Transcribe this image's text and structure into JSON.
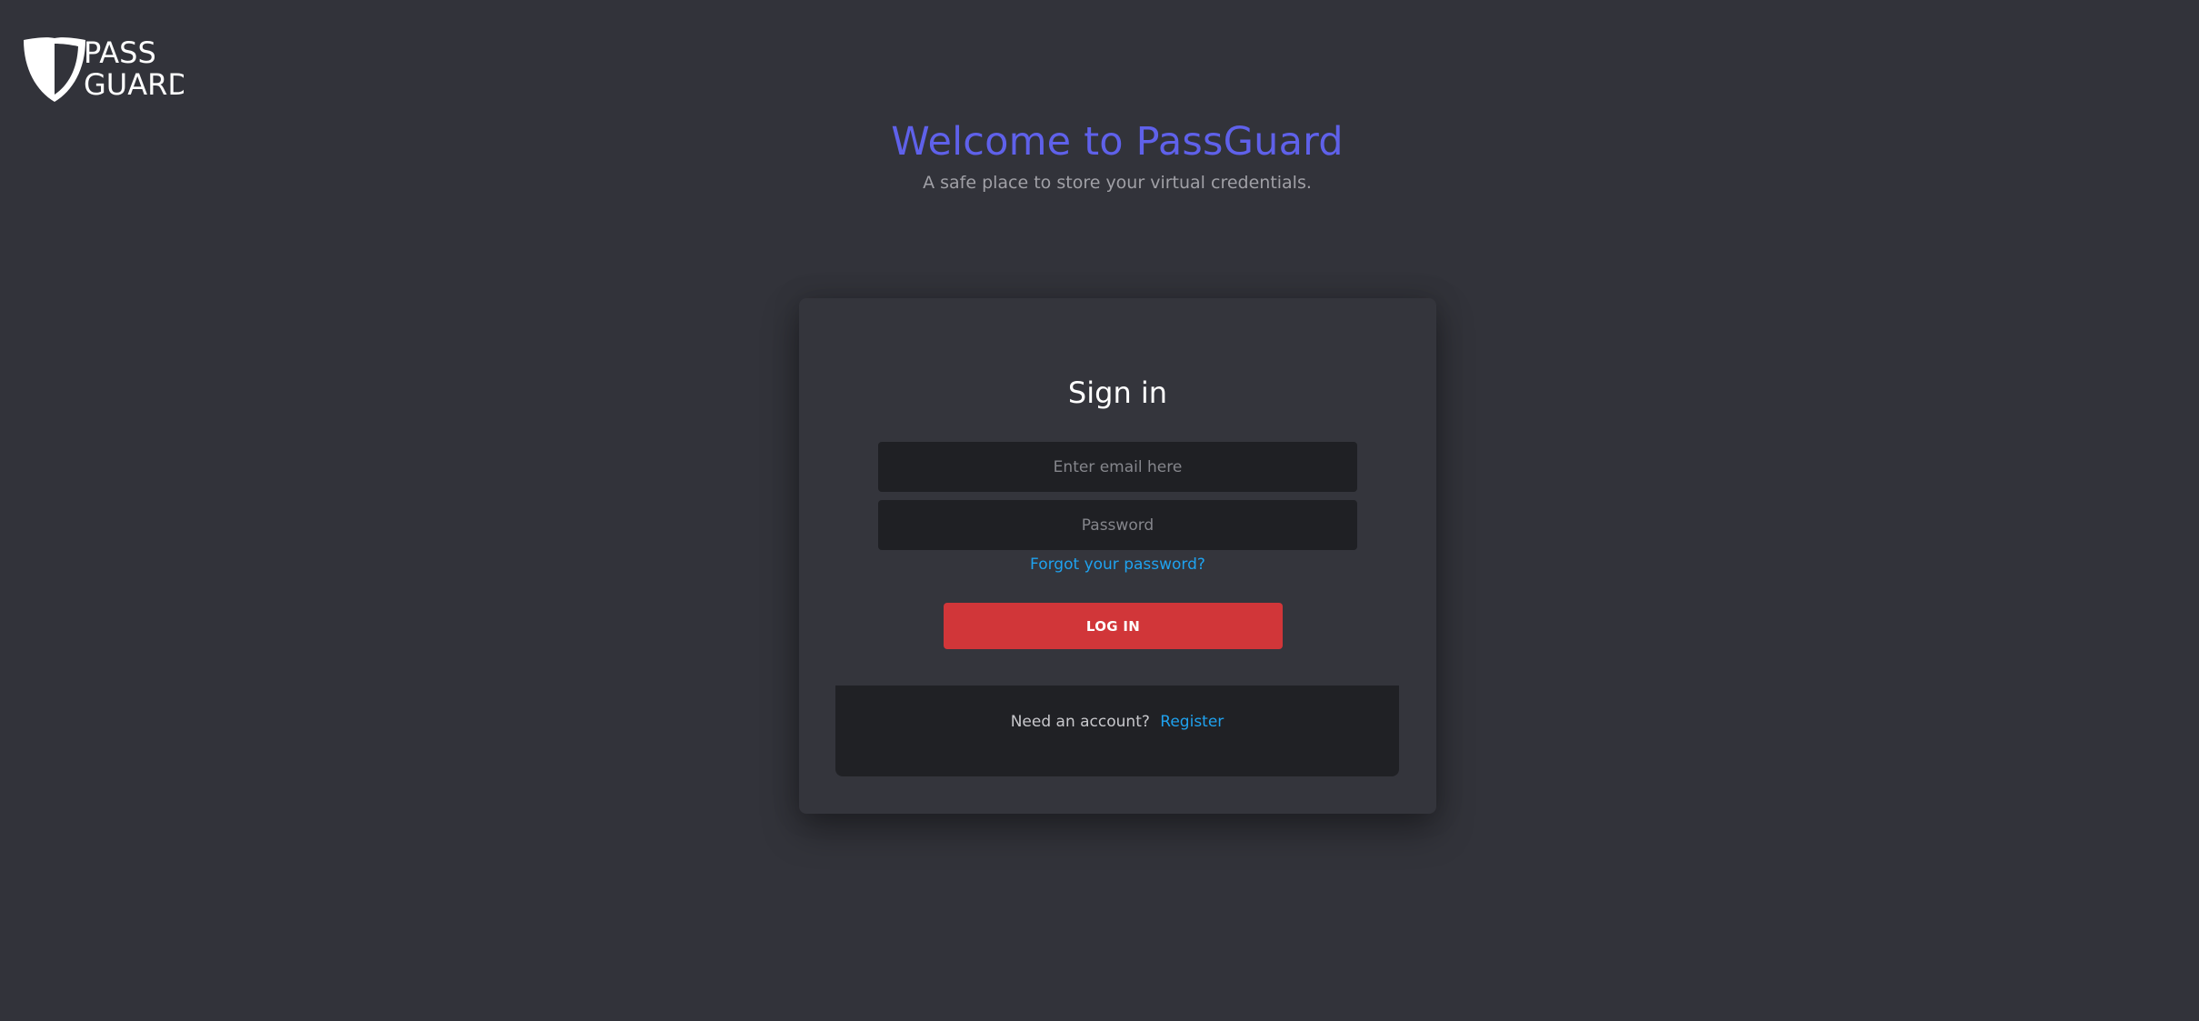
{
  "brand": {
    "logo_text_line1": "PASS",
    "logo_text_line2": "GUARD",
    "logo_icon": "shield-icon"
  },
  "hero": {
    "title": "Welcome to PassGuard",
    "subtitle": "A safe place to store your virtual credentials."
  },
  "login_card": {
    "title": "Sign in",
    "email_placeholder": "Enter email here",
    "email_value": "",
    "password_placeholder": "Password",
    "password_value": "",
    "forgot_password_label": "Forgot your password?",
    "login_button_label": "LOG IN",
    "footer_prompt": "Need an account?",
    "register_label": "Register"
  },
  "colors": {
    "background": "#32333a",
    "card": "#34353c",
    "field": "#1f2024",
    "accent_title": "#5f61ea",
    "link": "#1fa2ef",
    "button": "#d13639"
  }
}
